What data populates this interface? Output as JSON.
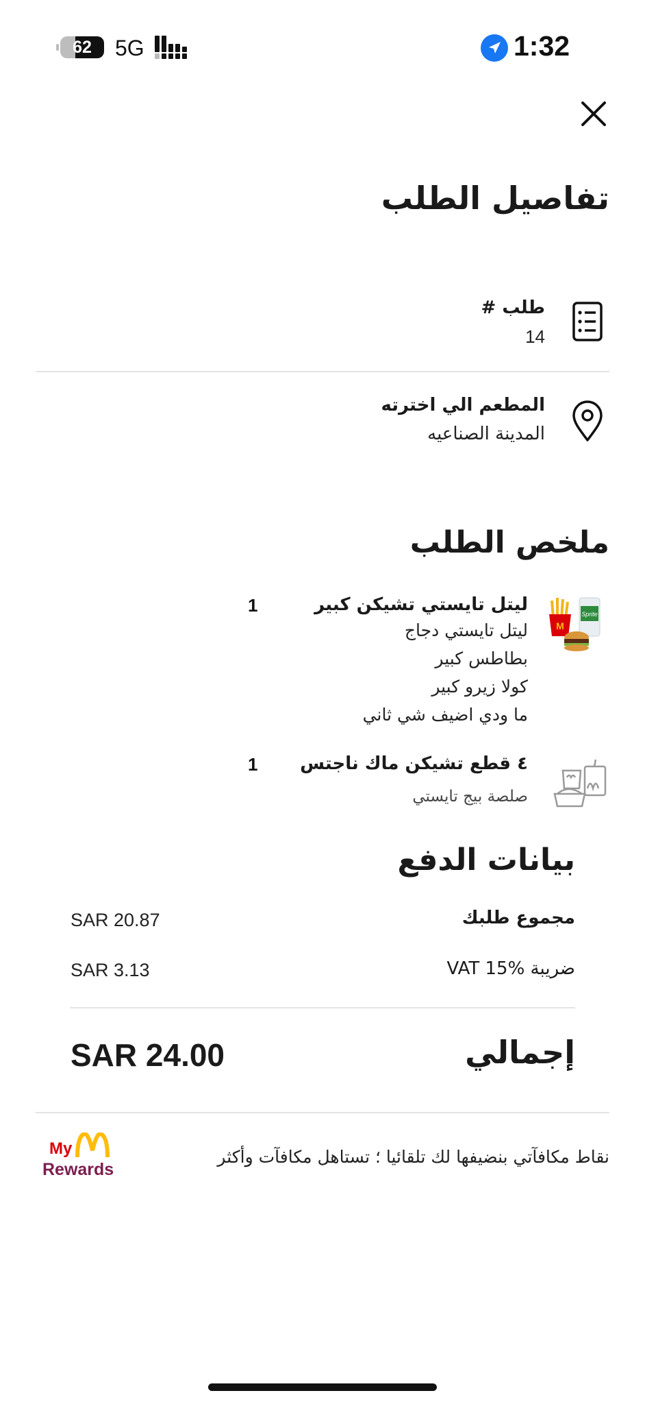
{
  "status_bar": {
    "battery": "62",
    "network": "5G",
    "time": "1:32"
  },
  "header": {
    "title": "تفاصيل الطلب"
  },
  "order": {
    "number_label": "طلب #",
    "number_value": "14",
    "restaurant_label": "المطعم الي اخترته",
    "restaurant_value": "المدينة الصناعيه"
  },
  "summary": {
    "title": "ملخص الطلب",
    "items": [
      {
        "name": "ليتل تايستي تشيكن كبير",
        "quantity": "1",
        "details": [
          "ليتل تايستي دجاج",
          "بطاطس كبير",
          "كولا زيرو كبير",
          "ما ودي اضيف شي ثاني"
        ],
        "image": "meal-combo"
      },
      {
        "name": "٤ قطع تشيكن ماك ناجتس",
        "quantity": "1",
        "details": [
          "صلصة بيج تايستي"
        ],
        "image": "placeholder-meal"
      }
    ]
  },
  "payment": {
    "title": "بيانات الدفع",
    "subtotal_label": "مجموع طلبك",
    "subtotal_value": "SAR 20.87",
    "vat_label": "ضريبة VAT 15%",
    "vat_value": "SAR 3.13",
    "total_label": "إجمالي",
    "total_value": "SAR 24.00"
  },
  "rewards": {
    "text": "نقاط مكافآتي بنضيفها لك تلقائيا ؛ تستاهل مكافآت وأكثر",
    "logo_my": "My",
    "logo_rewards": "Rewards"
  },
  "colors": {
    "accent_blue": "#1877f2",
    "mcd_yellow": "#ffbc0d",
    "mcd_red": "#db0007",
    "divider": "#e4e4e4"
  }
}
